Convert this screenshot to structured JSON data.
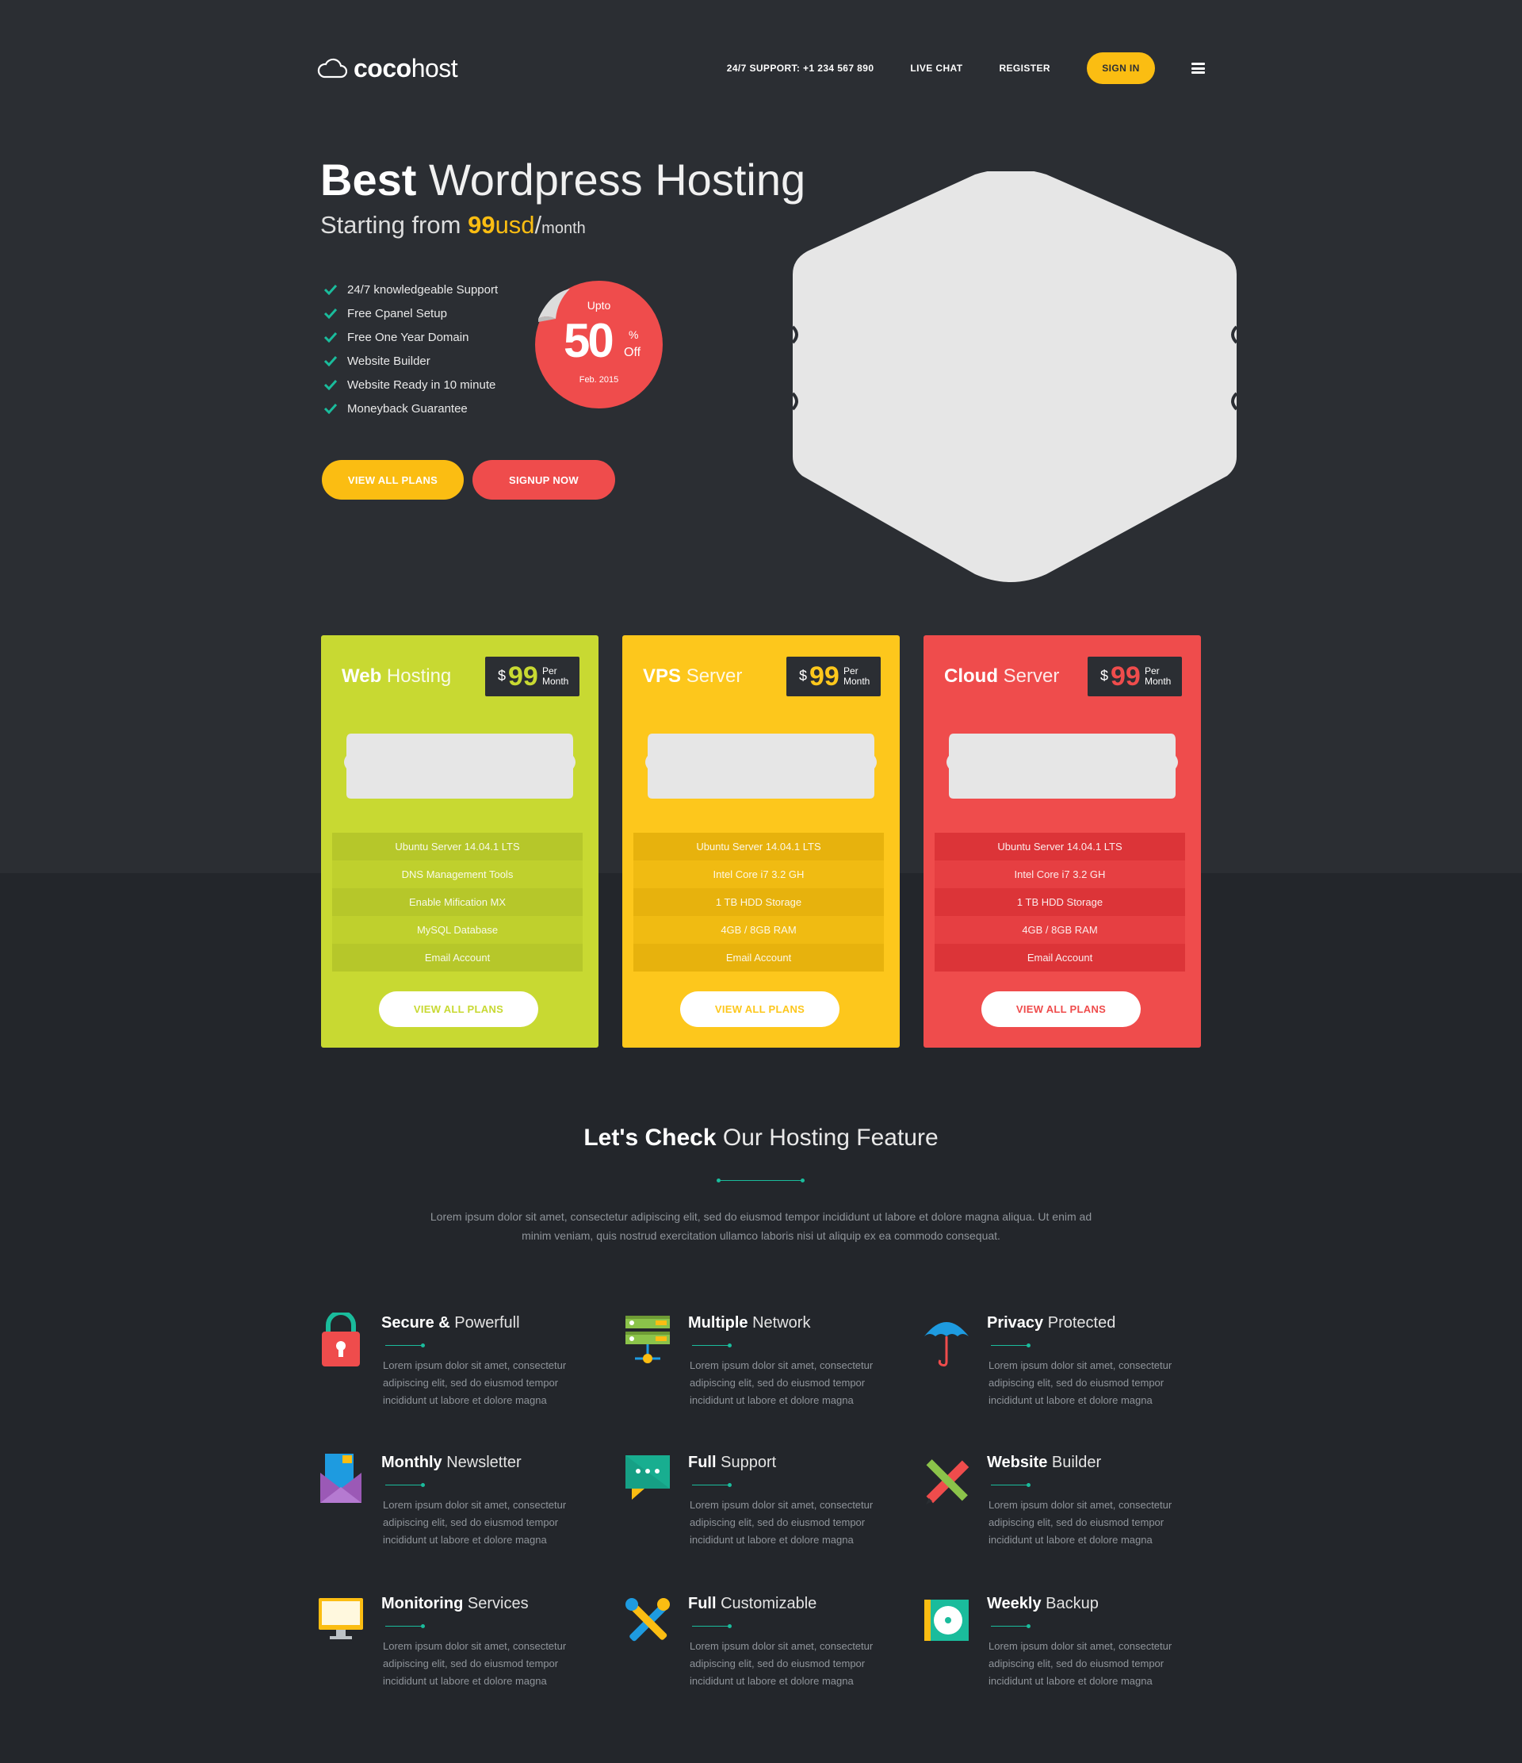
{
  "header": {
    "logo_bold": "coco",
    "logo_light": "host",
    "support": "24/7 SUPPORT: +1 234 567 890",
    "live_chat": "LIVE CHAT",
    "register": "REGISTER",
    "sign_in": "SIGN IN"
  },
  "hero": {
    "title_bold": "Best",
    "title_light": "Wordpress Hosting",
    "sub_prefix": "Starting from",
    "sub_price": "99",
    "sub_currency": "usd",
    "sub_slash": "/",
    "sub_period": "month",
    "features": [
      "24/7 knowledgeable Support",
      "Free Cpanel Setup",
      "Free One Year Domain",
      "Website Builder",
      "Website Ready in 10 minute",
      "Moneyback Guarantee"
    ],
    "badge": {
      "upto": "Upto",
      "number": "50",
      "percent": "%",
      "off": "Off",
      "date": "Feb. 2015"
    },
    "btn_plans": "VIEW ALL PLANS",
    "btn_signup": "SIGNUP NOW"
  },
  "plans": [
    {
      "name_bold": "Web",
      "name_light": "Hosting",
      "currency": "$",
      "price": "99",
      "per": "Per",
      "period": "Month",
      "specs": [
        "Ubuntu Server 14.04.1 LTS",
        "DNS Management Tools",
        "Enable Mification MX",
        "MySQL Database",
        "Email Account"
      ],
      "button": "VIEW ALL PLANS"
    },
    {
      "name_bold": "VPS",
      "name_light": "Server",
      "currency": "$",
      "price": "99",
      "per": "Per",
      "period": "Month",
      "specs": [
        "Ubuntu Server 14.04.1 LTS",
        "Intel Core i7 3.2 GH",
        "1 TB HDD Storage",
        "4GB / 8GB RAM",
        "Email Account"
      ],
      "button": "VIEW ALL PLANS"
    },
    {
      "name_bold": "Cloud",
      "name_light": "Server",
      "currency": "$",
      "price": "99",
      "per": "Per",
      "period": "Month",
      "specs": [
        "Ubuntu Server 14.04.1 LTS",
        "Intel Core i7 3.2 GH",
        "1 TB HDD Storage",
        "4GB / 8GB RAM",
        "Email Account"
      ],
      "button": "VIEW ALL PLANS"
    }
  ],
  "features_section": {
    "title_bold": "Let's Check",
    "title_light": "Our Hosting Feature",
    "description": "Lorem ipsum dolor sit amet, consectetur adipiscing elit, sed do eiusmod tempor incididunt ut labore et dolore magna aliqua. Ut enim ad minim veniam, quis nostrud exercitation ullamco laboris nisi ut aliquip ex ea commodo consequat.",
    "items": [
      {
        "bold": "Secure &",
        "light": "Powerfull",
        "icon": "lock-icon",
        "text": "Lorem ipsum dolor sit amet, consectetur adipiscing elit, sed do eiusmod tempor incididunt ut labore et dolore magna"
      },
      {
        "bold": "Multiple",
        "light": "Network",
        "icon": "server-network-icon",
        "text": "Lorem ipsum dolor sit amet, consectetur adipiscing elit, sed do eiusmod tempor incididunt ut labore et dolore magna"
      },
      {
        "bold": "Privacy",
        "light": "Protected",
        "icon": "umbrella-icon",
        "text": "Lorem ipsum dolor sit amet, consectetur adipiscing elit, sed do eiusmod tempor incididunt ut labore et dolore magna"
      },
      {
        "bold": "Monthly",
        "light": "Newsletter",
        "icon": "envelope-icon",
        "text": "Lorem ipsum dolor sit amet, consectetur adipiscing elit, sed do eiusmod tempor incididunt ut labore et dolore magna"
      },
      {
        "bold": "Full",
        "light": "Support",
        "icon": "chat-bubble-icon",
        "text": "Lorem ipsum dolor sit amet, consectetur adipiscing elit, sed do eiusmod tempor incididunt ut labore et dolore magna"
      },
      {
        "bold": "Website",
        "light": "Builder",
        "icon": "pencil-ruler-icon",
        "text": "Lorem ipsum dolor sit amet, consectetur adipiscing elit, sed do eiusmod tempor incididunt ut labore et dolore magna"
      },
      {
        "bold": "Monitoring",
        "light": "Services",
        "icon": "monitor-icon",
        "text": "Lorem ipsum dolor sit amet, consectetur adipiscing elit, sed do eiusmod tempor incididunt ut labore et dolore magna"
      },
      {
        "bold": "Full",
        "light": "Customizable",
        "icon": "wrench-screwdriver-icon",
        "text": "Lorem ipsum dolor sit amet, consectetur adipiscing elit, sed do eiusmod tempor incididunt ut labore et dolore magna"
      },
      {
        "bold": "Weekly",
        "light": "Backup",
        "icon": "backup-disk-icon",
        "text": "Lorem ipsum dolor sit amet, consectetur adipiscing elit, sed do eiusmod tempor incididunt ut labore et dolore magna"
      }
    ]
  },
  "colors": {
    "hero_bg": "#2b2e33",
    "page_bg": "#23262b",
    "yellow": "#fbbd12",
    "red": "#ef4c4c",
    "green": "#c8d932",
    "teal": "#1abc9c"
  }
}
